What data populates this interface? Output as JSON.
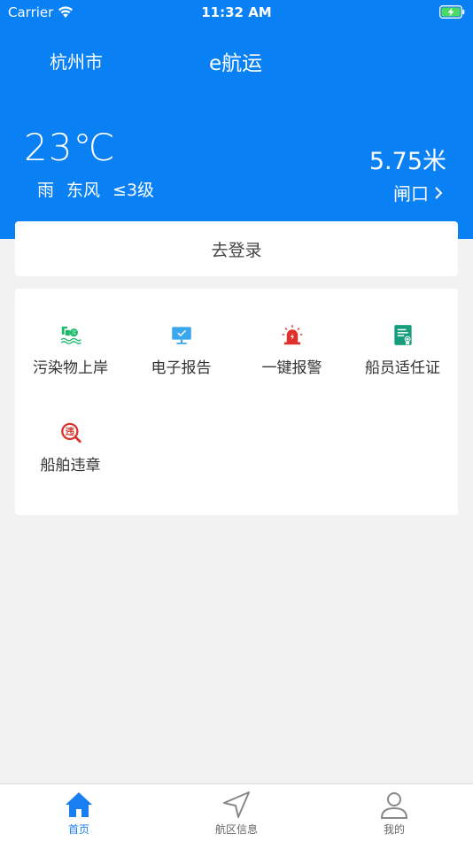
{
  "status_bar": {
    "carrier": "Carrier",
    "time": "11:32 AM"
  },
  "header": {
    "city": "杭州市",
    "title": "e航运",
    "temperature": "23℃",
    "weather": {
      "condition": "雨",
      "wind_direction": "东风",
      "wind_level": "≤3级"
    },
    "water_level": "5.75米",
    "station": "闸口"
  },
  "login": {
    "label": "去登录"
  },
  "services": [
    {
      "label": "污染物上岸",
      "icon_text": "污"
    },
    {
      "label": "电子报告"
    },
    {
      "label": "一键报警"
    },
    {
      "label": "船员适任证"
    },
    {
      "label": "船舶违章",
      "icon_text": "违"
    }
  ],
  "tabs": [
    {
      "label": "首页"
    },
    {
      "label": "航区信息"
    },
    {
      "label": "我的"
    }
  ],
  "colors": {
    "brand": "#0a80f5",
    "tab_active": "#1a7ff0",
    "pollution_green": "#1fb86a",
    "report_blue": "#3aa6ee",
    "alarm_red": "#e0302a",
    "certificate_teal": "#169e7c",
    "violation_red": "#d7352b"
  }
}
